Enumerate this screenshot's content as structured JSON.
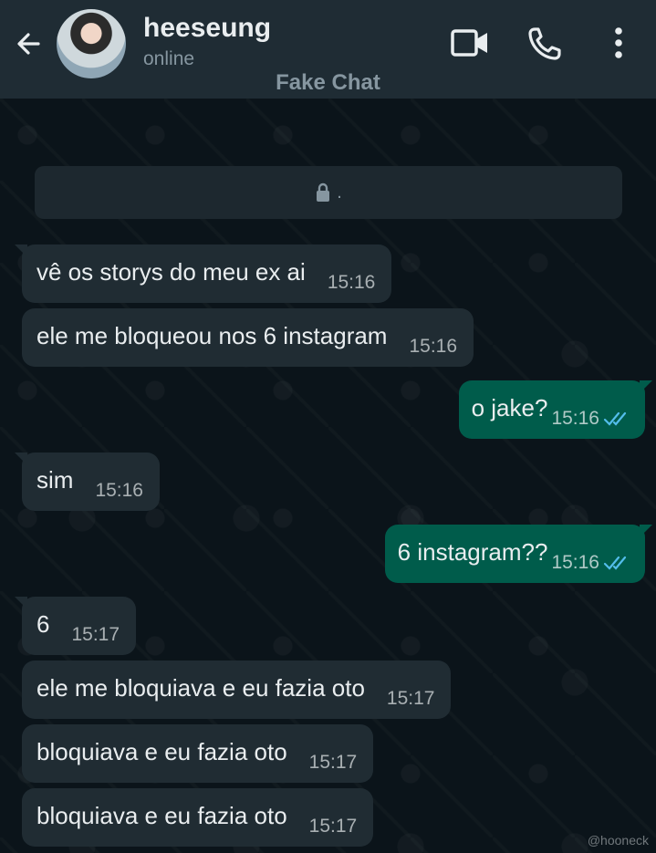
{
  "header": {
    "contact_name": "heeseung",
    "status": "online",
    "chat_label": "Fake Chat"
  },
  "encryption_notice": ".",
  "messages": [
    {
      "direction": "in",
      "text": "vê os storys do meu ex ai",
      "time": "15:16"
    },
    {
      "direction": "in",
      "text": "ele me bloqueou nos 6 instagram",
      "time": "15:16"
    },
    {
      "direction": "out",
      "text": "o jake?",
      "time": "15:16",
      "ticks": "read"
    },
    {
      "direction": "in",
      "text": "sim",
      "time": "15:16"
    },
    {
      "direction": "out",
      "text": "6 instagram??",
      "time": "15:16",
      "ticks": "read"
    },
    {
      "direction": "in",
      "text": "6",
      "time": "15:17"
    },
    {
      "direction": "in",
      "text": "ele me bloquiava e eu fazia oto",
      "time": "15:17"
    },
    {
      "direction": "in",
      "text": "bloquiava e eu fazia oto",
      "time": "15:17"
    },
    {
      "direction": "in",
      "text": "bloquiava e eu fazia oto",
      "time": "15:17"
    }
  ],
  "watermark": "@hooneck",
  "colors": {
    "header_bg": "#1f2c34",
    "chat_bg": "#0b141a",
    "incoming_bubble": "#202c33",
    "outgoing_bubble": "#005c4b",
    "read_ticks": "#53bdeb"
  },
  "icons": [
    "back-arrow-icon",
    "video-call-icon",
    "phone-icon",
    "more-vert-icon",
    "lock-icon",
    "double-check-icon"
  ]
}
